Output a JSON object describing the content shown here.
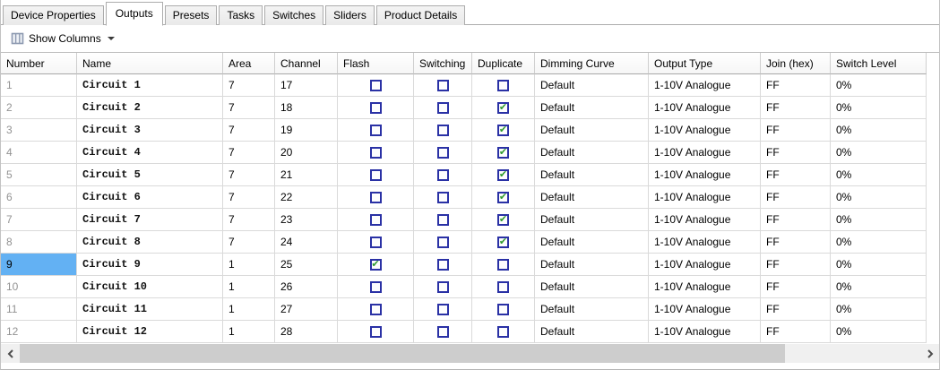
{
  "tabs": [
    {
      "label": "Device Properties",
      "active": false
    },
    {
      "label": "Outputs",
      "active": true
    },
    {
      "label": "Presets",
      "active": false
    },
    {
      "label": "Tasks",
      "active": false
    },
    {
      "label": "Switches",
      "active": false
    },
    {
      "label": "Sliders",
      "active": false
    },
    {
      "label": "Product Details",
      "active": false
    }
  ],
  "toolbar": {
    "show_columns_label": "Show Columns",
    "show_columns_icon": "columns-icon",
    "has_dropdown_caret": true
  },
  "table": {
    "columns": [
      {
        "key": "number",
        "label": "Number"
      },
      {
        "key": "name",
        "label": "Name"
      },
      {
        "key": "area",
        "label": "Area"
      },
      {
        "key": "channel",
        "label": "Channel"
      },
      {
        "key": "flash",
        "label": "Flash"
      },
      {
        "key": "switching",
        "label": "Switching"
      },
      {
        "key": "duplicate",
        "label": "Duplicate"
      },
      {
        "key": "dimming_curve",
        "label": "Dimming Curve"
      },
      {
        "key": "output_type",
        "label": "Output Type"
      },
      {
        "key": "join_hex",
        "label": "Join (hex)"
      },
      {
        "key": "switch_level",
        "label": "Switch Level"
      }
    ],
    "rows": [
      {
        "number": "1",
        "name": "Circuit 1",
        "area": "7",
        "channel": "17",
        "flash": false,
        "switching": false,
        "duplicate": false,
        "dimming_curve": "Default",
        "output_type": "1-10V Analogue",
        "join_hex": "FF",
        "switch_level": "0%"
      },
      {
        "number": "2",
        "name": "Circuit 2",
        "area": "7",
        "channel": "18",
        "flash": false,
        "switching": false,
        "duplicate": true,
        "dimming_curve": "Default",
        "output_type": "1-10V Analogue",
        "join_hex": "FF",
        "switch_level": "0%"
      },
      {
        "number": "3",
        "name": "Circuit 3",
        "area": "7",
        "channel": "19",
        "flash": false,
        "switching": false,
        "duplicate": true,
        "dimming_curve": "Default",
        "output_type": "1-10V Analogue",
        "join_hex": "FF",
        "switch_level": "0%"
      },
      {
        "number": "4",
        "name": "Circuit 4",
        "area": "7",
        "channel": "20",
        "flash": false,
        "switching": false,
        "duplicate": true,
        "dimming_curve": "Default",
        "output_type": "1-10V Analogue",
        "join_hex": "FF",
        "switch_level": "0%"
      },
      {
        "number": "5",
        "name": "Circuit 5",
        "area": "7",
        "channel": "21",
        "flash": false,
        "switching": false,
        "duplicate": true,
        "dimming_curve": "Default",
        "output_type": "1-10V Analogue",
        "join_hex": "FF",
        "switch_level": "0%"
      },
      {
        "number": "6",
        "name": "Circuit 6",
        "area": "7",
        "channel": "22",
        "flash": false,
        "switching": false,
        "duplicate": true,
        "dimming_curve": "Default",
        "output_type": "1-10V Analogue",
        "join_hex": "FF",
        "switch_level": "0%"
      },
      {
        "number": "7",
        "name": "Circuit 7",
        "area": "7",
        "channel": "23",
        "flash": false,
        "switching": false,
        "duplicate": true,
        "dimming_curve": "Default",
        "output_type": "1-10V Analogue",
        "join_hex": "FF",
        "switch_level": "0%"
      },
      {
        "number": "8",
        "name": "Circuit 8",
        "area": "7",
        "channel": "24",
        "flash": false,
        "switching": false,
        "duplicate": true,
        "dimming_curve": "Default",
        "output_type": "1-10V Analogue",
        "join_hex": "FF",
        "switch_level": "0%"
      },
      {
        "number": "9",
        "name": "Circuit 9",
        "area": "1",
        "channel": "25",
        "flash": true,
        "switching": false,
        "duplicate": false,
        "dimming_curve": "Default",
        "output_type": "1-10V Analogue",
        "join_hex": "FF",
        "switch_level": "0%"
      },
      {
        "number": "10",
        "name": "Circuit 10",
        "area": "1",
        "channel": "26",
        "flash": false,
        "switching": false,
        "duplicate": false,
        "dimming_curve": "Default",
        "output_type": "1-10V Analogue",
        "join_hex": "FF",
        "switch_level": "0%"
      },
      {
        "number": "11",
        "name": "Circuit 11",
        "area": "1",
        "channel": "27",
        "flash": false,
        "switching": false,
        "duplicate": false,
        "dimming_curve": "Default",
        "output_type": "1-10V Analogue",
        "join_hex": "FF",
        "switch_level": "0%"
      },
      {
        "number": "12",
        "name": "Circuit 12",
        "area": "1",
        "channel": "28",
        "flash": false,
        "switching": false,
        "duplicate": false,
        "dimming_curve": "Default",
        "output_type": "1-10V Analogue",
        "join_hex": "FF",
        "switch_level": "0%"
      }
    ],
    "selected_cell": {
      "row_number": "9",
      "column": "number"
    }
  },
  "scrollbar": {
    "orientation": "horizontal",
    "thumb_left_pct": 0,
    "thumb_width_pct": 85
  },
  "colors": {
    "selected_cell_bg": "#63b1f3",
    "checkbox_border": "#2a31a5",
    "checkbox_check": "#2f9b2f",
    "tab_border": "#acacac",
    "grid_line": "#dadada",
    "row_number_text": "#929292",
    "scroll_track": "#f0f0f0",
    "scroll_thumb": "#cdcdcd"
  }
}
